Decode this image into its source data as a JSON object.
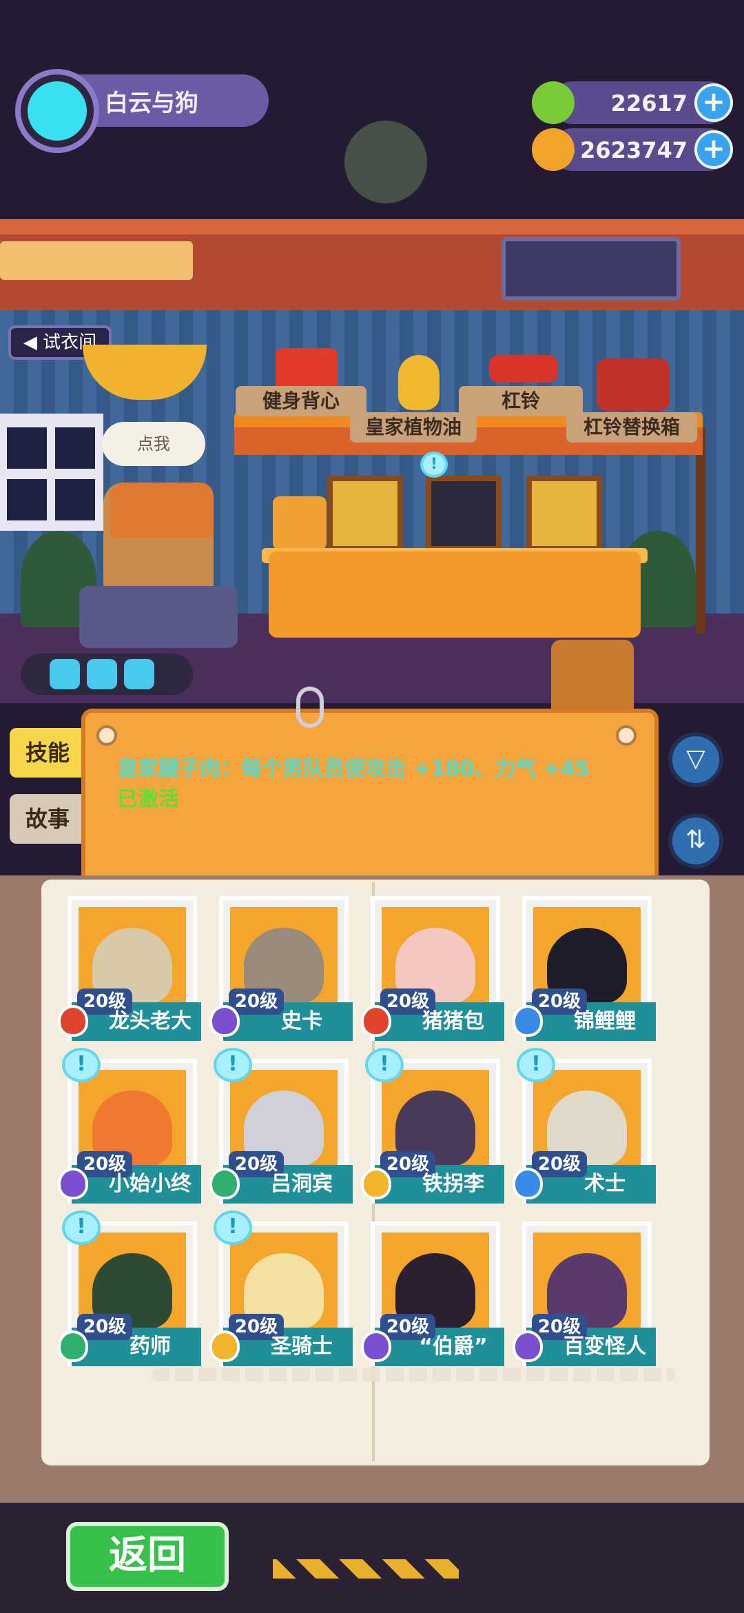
{
  "user": {
    "name": "白云与狗"
  },
  "currencies": [
    {
      "name": "gem",
      "value": "22617",
      "icon": "green-donut-icon",
      "color": "#7acb38"
    },
    {
      "name": "coin",
      "value": "2623747",
      "icon": "planet-coin-icon",
      "color": "#f2a32a"
    }
  ],
  "fitting_room": {
    "label": "试衣间"
  },
  "bubble": {
    "text": "点我"
  },
  "shelf_items": [
    "健身背心",
    "杠铃",
    "皇家植物油",
    "杠铃替换箱"
  ],
  "tabs": [
    "技能",
    "故事"
  ],
  "skill": {
    "text": "皇家腱子肉：每个男队员使攻击 +180、力气 +45",
    "status": "已激活"
  },
  "back": {
    "label": "返回"
  },
  "roster": [
    {
      "name": "龙头老大",
      "level": "20级",
      "badge": "red",
      "alert": false
    },
    {
      "name": "史卡",
      "level": "20级",
      "badge": "purple",
      "alert": false
    },
    {
      "name": "猪猪包",
      "level": "20级",
      "badge": "red",
      "alert": false
    },
    {
      "name": "锦鲤鲤",
      "level": "20级",
      "badge": "blue",
      "alert": false
    },
    {
      "name": "小始小终",
      "level": "20级",
      "badge": "purple",
      "alert": true
    },
    {
      "name": "吕洞宾",
      "level": "20级",
      "badge": "green",
      "alert": true
    },
    {
      "name": "铁拐李",
      "level": "20级",
      "badge": "yellow",
      "alert": true
    },
    {
      "name": "术士",
      "level": "20级",
      "badge": "blue",
      "alert": true
    },
    {
      "name": "药师",
      "level": "20级",
      "badge": "green",
      "alert": true
    },
    {
      "name": "圣骑士",
      "level": "20级",
      "badge": "yellow",
      "alert": true
    },
    {
      "name": "“伯爵”",
      "level": "20级",
      "badge": "purple",
      "alert": false
    },
    {
      "name": "百变怪人",
      "level": "20级",
      "badge": "purple",
      "alert": false
    }
  ],
  "colors": {
    "red": "#e0442c",
    "purple": "#7a4fd0",
    "blue": "#3a8ae8",
    "green": "#2fb070",
    "yellow": "#f0b52a"
  }
}
